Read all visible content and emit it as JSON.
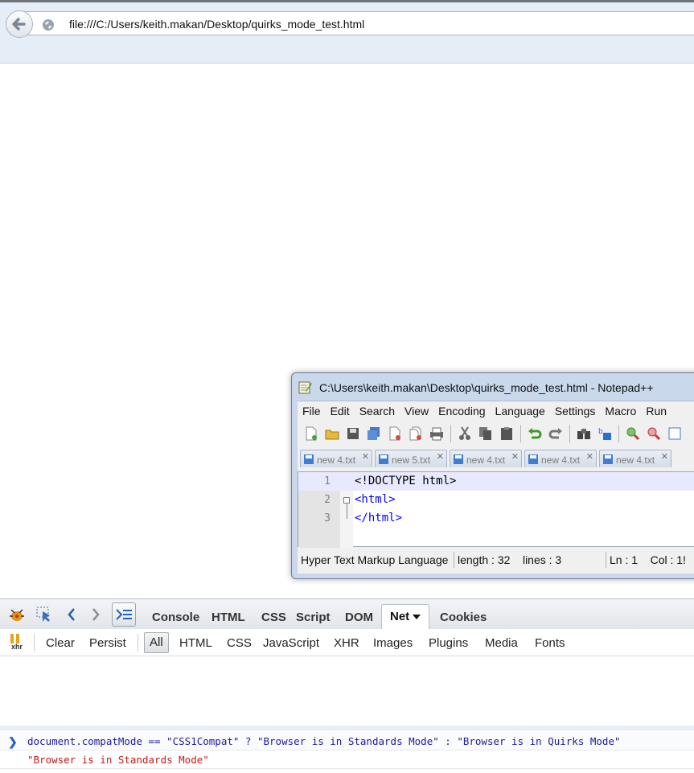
{
  "browser": {
    "url": "file:///C:/Users/keith.makan/Desktop/quirks_mode_test.html"
  },
  "notepad": {
    "title": "C:\\Users\\keith.makan\\Desktop\\quirks_mode_test.html - Notepad++",
    "menu": [
      "File",
      "Edit",
      "Search",
      "View",
      "Encoding",
      "Language",
      "Settings",
      "Macro",
      "Run"
    ],
    "tabs": [
      {
        "label": "new 4.txt"
      },
      {
        "label": "new 5.txt"
      },
      {
        "label": "new 4.txt"
      },
      {
        "label": "new 4.txt"
      },
      {
        "label": "new 4.txt"
      }
    ],
    "lines": [
      {
        "num": "1",
        "code": "<!DOCTYPE html>"
      },
      {
        "num": "2",
        "code": "<html>"
      },
      {
        "num": "3",
        "code": "</html>"
      }
    ],
    "status": {
      "language": "Hyper Text Markup Language",
      "length": "length : 32",
      "lines": "lines : 3",
      "ln": "Ln : 1",
      "col": "Col : 1!"
    }
  },
  "firebug": {
    "panel_tabs": [
      "Console",
      "HTML",
      "CSS",
      "Script",
      "DOM",
      "Net",
      "Cookies"
    ],
    "active_tab": "Net",
    "sub_actions": [
      "Clear",
      "Persist"
    ],
    "filters": [
      "All",
      "HTML",
      "CSS",
      "JavaScript",
      "XHR",
      "Images",
      "Plugins",
      "Media",
      "Fonts"
    ],
    "xhr_label": "xhr",
    "command": "document.compatMode == \"CSS1Compat\" ? \"Browser is in Standards Mode\" : \"Browser is in Quirks Mode\"",
    "result": "\"Browser is in Standards Mode\""
  }
}
